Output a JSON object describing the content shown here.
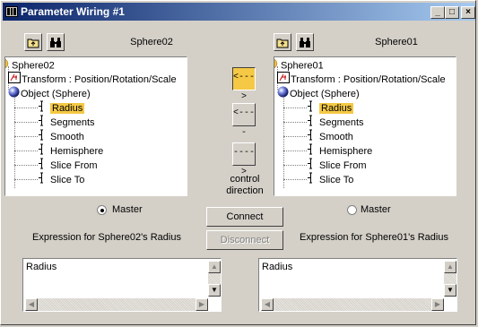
{
  "window": {
    "title": "Parameter Wiring #1"
  },
  "left": {
    "object_name": "Sphere02",
    "tree": [
      {
        "label": "Sphere02",
        "level": 0,
        "icon": "sphere-dot-icon",
        "selected": false
      },
      {
        "label": "Transform : Position/Rotation/Scale",
        "level": 1,
        "icon": "transform-icon",
        "selected": false
      },
      {
        "label": "Object (Sphere)",
        "level": 1,
        "icon": "sphere-icon",
        "selected": false
      },
      {
        "label": "Radius",
        "level": 2,
        "icon": "param-icon",
        "selected": true
      },
      {
        "label": "Segments",
        "level": 2,
        "icon": "param-icon",
        "selected": false
      },
      {
        "label": "Smooth",
        "level": 2,
        "icon": "param-icon",
        "selected": false
      },
      {
        "label": "Hemisphere",
        "level": 2,
        "icon": "param-icon",
        "selected": false
      },
      {
        "label": "Slice From",
        "level": 2,
        "icon": "param-icon",
        "selected": false
      },
      {
        "label": "Slice To",
        "level": 2,
        "icon": "param-icon",
        "selected": false
      }
    ],
    "master_label": "Master",
    "master_checked": true,
    "expression_label": "Expression for Sphere02's Radius",
    "expression_value": "Radius"
  },
  "right": {
    "object_name": "Sphere01",
    "tree": [
      {
        "label": "Sphere01",
        "level": 0,
        "icon": "sphere-dot-icon",
        "selected": false
      },
      {
        "label": "Transform : Position/Rotation/Scale",
        "level": 1,
        "icon": "transform-icon",
        "selected": false
      },
      {
        "label": "Object (Sphere)",
        "level": 1,
        "icon": "sphere-icon",
        "selected": false
      },
      {
        "label": "Radius",
        "level": 2,
        "icon": "param-icon",
        "selected": true
      },
      {
        "label": "Segments",
        "level": 2,
        "icon": "param-icon",
        "selected": false
      },
      {
        "label": "Smooth",
        "level": 2,
        "icon": "param-icon",
        "selected": false
      },
      {
        "label": "Hemisphere",
        "level": 2,
        "icon": "param-icon",
        "selected": false
      },
      {
        "label": "Slice From",
        "level": 2,
        "icon": "param-icon",
        "selected": false
      },
      {
        "label": "Slice To",
        "level": 2,
        "icon": "param-icon",
        "selected": false
      }
    ],
    "master_label": "Master",
    "master_checked": false,
    "expression_label": "Expression for Sphere01's Radius",
    "expression_value": "Radius"
  },
  "center": {
    "bidirectional_label": "<--->",
    "left_arrow_label": "<----",
    "right_arrow_label": "---->",
    "direction_line1": "control",
    "direction_line2": "direction",
    "connect_label": "Connect",
    "disconnect_label": "Disconnect"
  },
  "colors": {
    "selection": "#f5c845",
    "title_start": "#0a246a",
    "title_end": "#a6caf0"
  }
}
